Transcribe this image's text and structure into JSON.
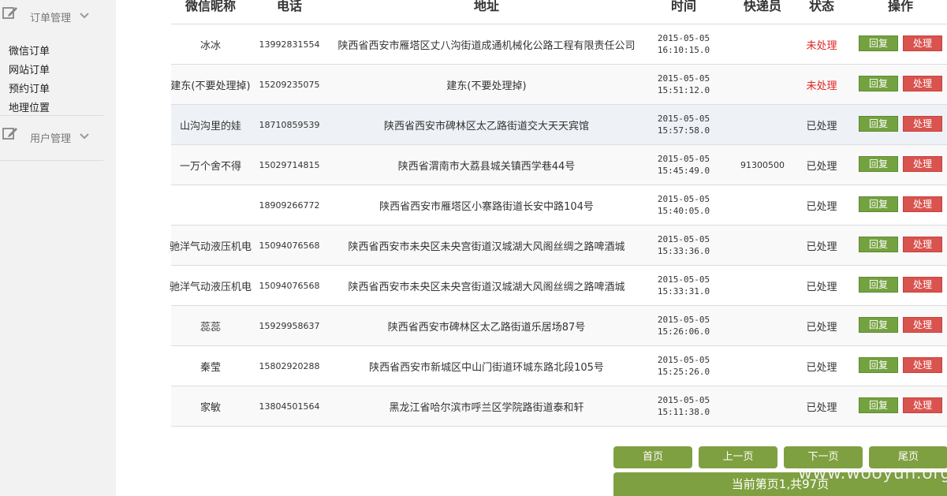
{
  "sidebar": {
    "groups": [
      {
        "label": "订单管理",
        "icon": "edit-icon",
        "expand_icon": "chevron-down-icon"
      },
      {
        "label": "用户管理",
        "icon": "edit-icon",
        "expand_icon": "chevron-down-icon"
      }
    ],
    "order_links": [
      "微信订单",
      "网站订单",
      "预约订单",
      "地理位置"
    ]
  },
  "table": {
    "headers": [
      "微信昵称",
      "电话",
      "地址",
      "时间",
      "快递员",
      "状态",
      "操作"
    ],
    "reply_label": "回复",
    "handle_label": "处理",
    "colors": {
      "reply": "#74a240",
      "handle": "#d9534f",
      "status_unhandled": "#e02424"
    },
    "rows": [
      {
        "name": "冰冰",
        "phone": "13992831554",
        "address": "陕西省西安市雁塔区丈八沟街道成通机械化公路工程有限责任公司",
        "date": "2015-05-05",
        "time": "16:10:15.0",
        "courier": "",
        "status": "未处理"
      },
      {
        "name": "建东(不要处理掉)",
        "phone": "15209235075",
        "address": "建东(不要处理掉)",
        "date": "2015-05-05",
        "time": "15:51:12.0",
        "courier": "",
        "status": "未处理"
      },
      {
        "name": "山沟沟里的娃",
        "phone": "18710859539",
        "address": "陕西省西安市碑林区太乙路街道交大天天宾馆",
        "date": "2015-05-05",
        "time": "15:57:58.0",
        "courier": "",
        "status": "已处理"
      },
      {
        "name": "一万个舍不得",
        "phone": "15029714815",
        "address": "陕西省渭南市大荔县城关镇西学巷44号",
        "date": "2015-05-05",
        "time": "15:45:49.0",
        "courier": "91300500",
        "status": "已处理"
      },
      {
        "name": "",
        "phone": "18909266772",
        "address": "陕西省西安市雁塔区小寨路街道长安中路104号",
        "date": "2015-05-05",
        "time": "15:40:05.0",
        "courier": "",
        "status": "已处理"
      },
      {
        "name": "驰洋气动液压机电",
        "phone": "15094076568",
        "address": "陕西省西安市未央区未央宫街道汉城湖大风阁丝绸之路啤酒城",
        "date": "2015-05-05",
        "time": "15:33:36.0",
        "courier": "",
        "status": "已处理"
      },
      {
        "name": "驰洋气动液压机电",
        "phone": "15094076568",
        "address": "陕西省西安市未央区未央宫街道汉城湖大风阁丝绸之路啤酒城",
        "date": "2015-05-05",
        "time": "15:33:31.0",
        "courier": "",
        "status": "已处理"
      },
      {
        "name": "蕊蕊",
        "phone": "15929958637",
        "address": "陕西省西安市碑林区太乙路街道乐居场87号",
        "date": "2015-05-05",
        "time": "15:26:06.0",
        "courier": "",
        "status": "已处理"
      },
      {
        "name": "秦莹",
        "phone": "15802920288",
        "address": "陕西省西安市新城区中山门街道环城东路北段105号",
        "date": "2015-05-05",
        "time": "15:25:26.0",
        "courier": "",
        "status": "已处理"
      },
      {
        "name": "家敏",
        "phone": "13804501564",
        "address": "黑龙江省哈尔滨市呼兰区学院路街道泰和轩",
        "date": "2015-05-05",
        "time": "15:11:38.0",
        "courier": "",
        "status": "已处理"
      }
    ]
  },
  "pagination": {
    "first": "首页",
    "prev": "上一页",
    "next": "下一页",
    "last": "尾页",
    "info": "当前第页1,共97页",
    "accent": "#7fa040"
  },
  "watermark": "www.wooyun.org"
}
